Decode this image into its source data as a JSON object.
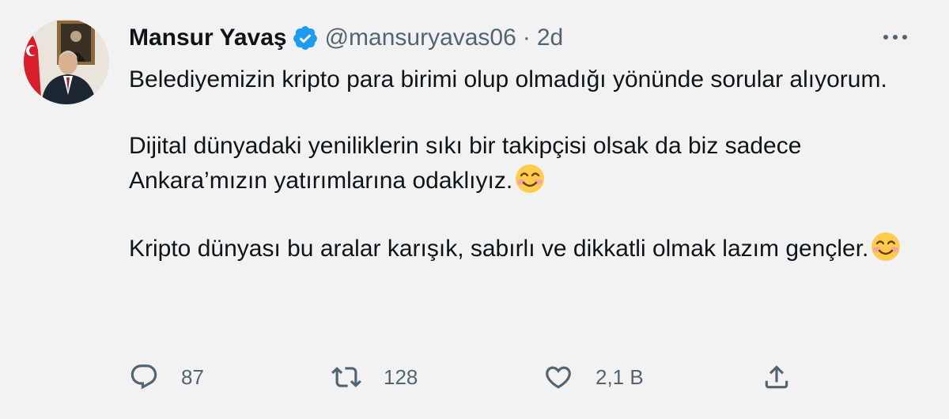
{
  "tweet": {
    "author": {
      "display_name": "Mansur Yavaş",
      "handle": "@mansuryavas06",
      "verified": true,
      "separator": "·",
      "time": "2d"
    },
    "paragraphs": [
      "Belediyemizin kripto para birimi olup olmadığı yönünde sorular alıyorum.",
      "Dijital dünyadaki yeniliklerin sıkı bir takipçisi olsak da biz sadece Ankara’mızın yatırımlarına odaklıyız.",
      "Kripto dünyası bu aralar karışık, sabırlı ve dikkatli olmak lazım gençler."
    ],
    "emoji": "smiling-face-with-smiling-eyes",
    "actions": {
      "reply_count": "87",
      "retweet_count": "128",
      "like_count": "2,1 B"
    }
  },
  "colors": {
    "background": "#f2f2f2",
    "text": "#0f1419",
    "secondary": "#536471",
    "verified": "#1d9bf0"
  },
  "icons": {
    "more": "more-horizontal-icon",
    "reply": "reply-bubble-icon",
    "retweet": "retweet-arrows-icon",
    "like": "heart-icon",
    "share": "share-upload-icon"
  }
}
